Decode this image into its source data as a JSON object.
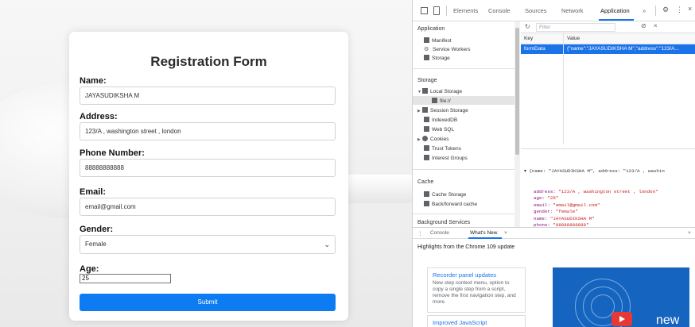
{
  "form": {
    "title": "Registration Form",
    "name_label": "Name:",
    "name_value": "JAYASUDIKSHA M",
    "address_label": "Address:",
    "address_value": "123/A , washington street , london",
    "phone_label": "Phone Number:",
    "phone_value": "88888888888",
    "email_label": "Email:",
    "email_value": "email@gmail.com",
    "gender_label": "Gender:",
    "gender_value": "Female",
    "age_label": "Age:",
    "age_value": "25",
    "submit_label": "Submit"
  },
  "devtools": {
    "tabs": [
      "Elements",
      "Console",
      "Sources",
      "Network",
      "Application"
    ],
    "more": "»",
    "active_tab": "Application",
    "sidebar": {
      "application_header": "Application",
      "application_items": [
        "Manifest",
        "Service Workers",
        "Storage"
      ],
      "storage_header": "Storage",
      "local_storage": "Local Storage",
      "local_storage_child": "file://",
      "storage_items": [
        "Session Storage",
        "IndexedDB",
        "Web SQL",
        "Cookies",
        "Trust Tokens",
        "Interest Groups"
      ],
      "cache_header": "Cache",
      "cache_items": [
        "Cache Storage",
        "Back/forward cache"
      ],
      "background_header": "Background Services"
    },
    "filter_placeholder": "Filter",
    "table": {
      "key_header": "Key",
      "value_header": "Value",
      "row_key": "formData",
      "row_value": "{\"name\":\"JAYASUDIKSHA M\",\"address\":\"123/A..."
    },
    "json_preview": {
      "summary": "▾ {name: \"JAYASUDIKSHA M\", address: \"123/A , washin",
      "lines": [
        {
          "k": "address",
          "v": "\"123/A , washington street , london\""
        },
        {
          "k": "age",
          "v": "\"25\""
        },
        {
          "k": "email",
          "v": "\"email@gmail.com\""
        },
        {
          "k": "gender",
          "v": "\"female\""
        },
        {
          "k": "name",
          "v": "\"JAYASUDIKSHA M\""
        },
        {
          "k": "phone",
          "v": "\"88888888888\""
        }
      ]
    },
    "drawer": {
      "menu": "⋮",
      "tabs": [
        "Console",
        "What's New"
      ],
      "close": "×",
      "highlights": "Highlights from the Chrome 109 update",
      "card1_title": "Recorder panel updates",
      "card1_body": "New step context menu, option to copy a single step from a script, remove the first navigation step, and more.",
      "card2_title": "Improved JavaScript",
      "promo_word": "new"
    }
  }
}
